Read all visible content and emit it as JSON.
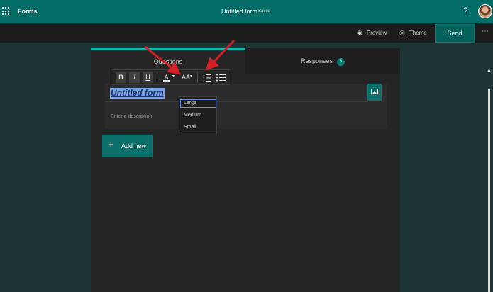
{
  "topbar": {
    "app_name": "Forms",
    "doc_title": "Untitled form",
    "doc_status": "Saved",
    "help_icon": "?",
    "accent": "#046c66"
  },
  "cmdbar": {
    "preview_label": "Preview",
    "theme_label": "Theme",
    "send_label": "Send",
    "more_icon": "⋯"
  },
  "tabs": {
    "questions_label": "Questions",
    "responses_label": "Responses",
    "responses_count": "3"
  },
  "toolbar": {
    "bold": "B",
    "italic": "I",
    "underline": "U",
    "font_color": "A",
    "font_size": "AA",
    "caret": "▾",
    "ordered_list_icon": "ordered-list",
    "bulleted_list_icon": "bulleted-list"
  },
  "form": {
    "title": "Untitled form",
    "description_placeholder": "Enter a description"
  },
  "font_size_menu": {
    "options": [
      "Large",
      "Medium",
      "Small"
    ],
    "selected": "Large"
  },
  "add_new": {
    "plus": "+",
    "label": "Add new"
  },
  "annotation_color": "#d61f26"
}
